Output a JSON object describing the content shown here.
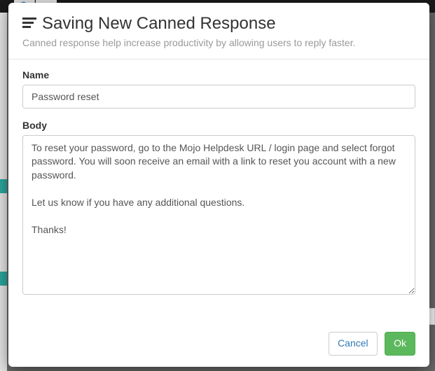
{
  "modal": {
    "title": "Saving New Canned Response",
    "subtitle": "Canned response help increase productivity by allowing users to reply faster.",
    "name_label": "Name",
    "name_value": "Password reset",
    "body_label": "Body",
    "body_value": "To reset your password, go to the Mojo Helpdesk URL / login page and select forgot password. You will soon receive an email with a link to reset you account with a new password.\n\nLet us know if you have any additional questions.\n\nThanks!",
    "cancel_label": "Cancel",
    "ok_label": "Ok"
  }
}
